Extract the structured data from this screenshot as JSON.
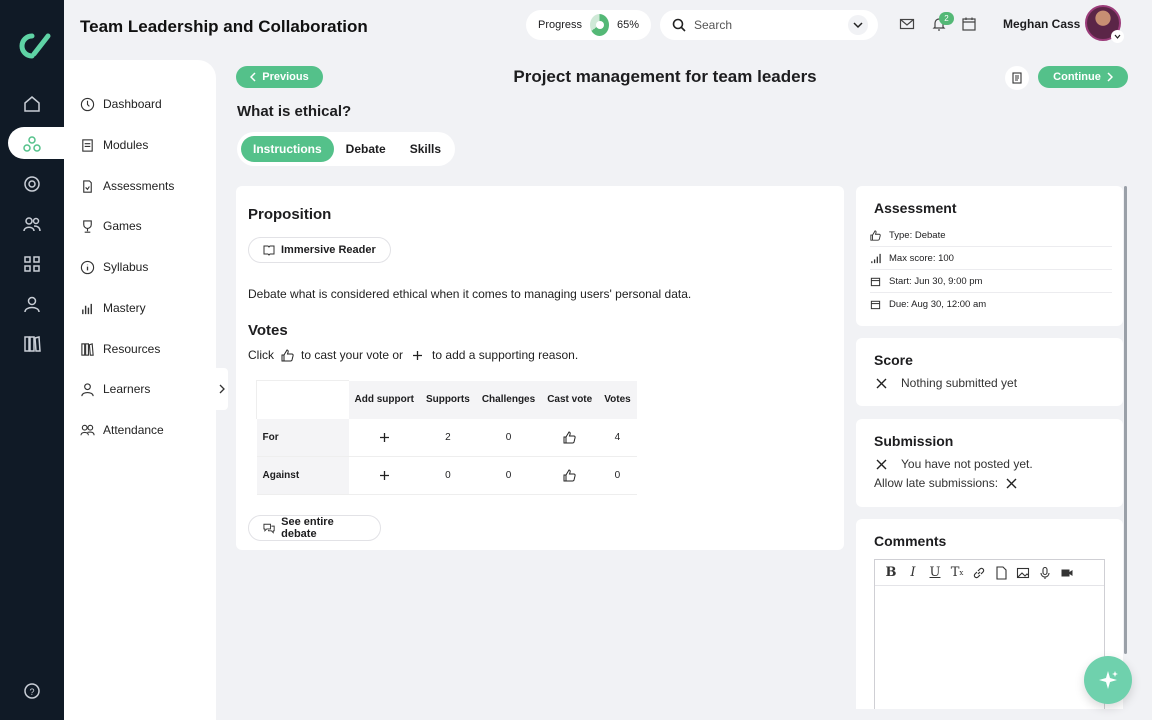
{
  "app": {
    "title": "Team Leadership and Collaboration"
  },
  "header": {
    "progress_label": "Progress",
    "progress_value": "65%",
    "progress_fraction": 0.65,
    "search_placeholder": "Search",
    "notifications_count": "2",
    "user_name": "Meghan Cass"
  },
  "sidebar": {
    "items": [
      {
        "label": "Dashboard",
        "icon": "dashboard-icon"
      },
      {
        "label": "Modules",
        "icon": "modules-icon"
      },
      {
        "label": "Assessments",
        "icon": "assessments-icon"
      },
      {
        "label": "Games",
        "icon": "trophy-icon"
      },
      {
        "label": "Syllabus",
        "icon": "info-icon"
      },
      {
        "label": "Mastery",
        "icon": "bar-chart-icon"
      },
      {
        "label": "Resources",
        "icon": "books-icon"
      },
      {
        "label": "Learners",
        "icon": "user-icon"
      },
      {
        "label": "Attendance",
        "icon": "group-icon"
      }
    ]
  },
  "content": {
    "previous_label": "Previous",
    "continue_label": "Continue",
    "page_title": "Project management for team leaders",
    "question": "What is ethical?",
    "tabs": [
      {
        "label": "Instructions",
        "active": true
      },
      {
        "label": "Debate",
        "active": false
      },
      {
        "label": "Skills",
        "active": false
      }
    ],
    "proposition_heading": "Proposition",
    "immersive_reader_label": "Immersive Reader",
    "proposition_text": "Debate what is considered ethical when it comes to managing users' personal data.",
    "votes_heading": "Votes",
    "votes_hint_click": "Click",
    "votes_hint_vote": "to cast your vote or",
    "votes_hint_add": "to add a supporting reason.",
    "table": {
      "headers": [
        "Add support",
        "Supports",
        "Challenges",
        "Cast vote",
        "Votes"
      ],
      "rows": [
        {
          "label": "For",
          "supports": "2",
          "challenges": "0",
          "votes": "4"
        },
        {
          "label": "Against",
          "supports": "0",
          "challenges": "0",
          "votes": "0"
        }
      ]
    },
    "see_debate_label": "See entire debate"
  },
  "assessment": {
    "heading": "Assessment",
    "type": "Type: Debate",
    "max_score": "Max score: 100",
    "start": "Start: Jun 30, 9:00 pm",
    "due": "Due: Aug 30, 12:00 am"
  },
  "score": {
    "heading": "Score",
    "status": "Nothing submitted yet"
  },
  "submission": {
    "heading": "Submission",
    "status": "You have not posted yet.",
    "late_label": "Allow late submissions:"
  },
  "comments": {
    "heading": "Comments"
  },
  "colors": {
    "accent": "#54c18a",
    "rail": "#101a26"
  }
}
